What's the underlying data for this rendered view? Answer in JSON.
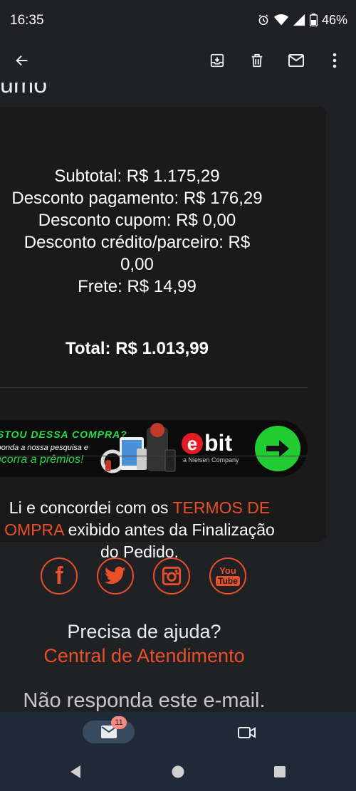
{
  "status": {
    "time": "16:35",
    "battery": "46%"
  },
  "email": {
    "heading_fragment": "umo"
  },
  "summary": {
    "lines": [
      "Subtotal: R$ 1.175,29",
      "Desconto pagamento: R$ 176,29",
      "Desconto cupom: R$ 0,00",
      "Desconto crédito/parceiro: R$",
      "0,00",
      "Frete: R$ 14,99"
    ],
    "total": "Total: R$ 1.013,99"
  },
  "banner": {
    "line1": "OSTOU DESSA COMPRA?",
    "line2": "esponda a nossa pesquisa e",
    "line3": "oncorra a prêmios!",
    "logo_e": "e",
    "logo_rest": "bit",
    "logo_sub": "a Nielsen Company"
  },
  "terms": {
    "line1_prefix": "Li e concordei com os ",
    "line1_link": "TERMOS DE",
    "line2_link": "OMPRA",
    "line2_suffix": " exibido antes da Finalização",
    "line3": "do Pedido."
  },
  "socials": {
    "facebook_label": "f",
    "youtube_top": "You",
    "youtube_bottom": "Tube"
  },
  "help": {
    "title": "Precisa de ajuda?",
    "link": "Central de Atendimento",
    "no_reply": "Não responda este e-mail."
  },
  "bottom_nav": {
    "mail_badge": "11"
  },
  "colors": {
    "accent": "#e8502a",
    "ebit_green": "#22cc33",
    "ebit_red": "#e31b23",
    "badge": "#f28b82"
  }
}
